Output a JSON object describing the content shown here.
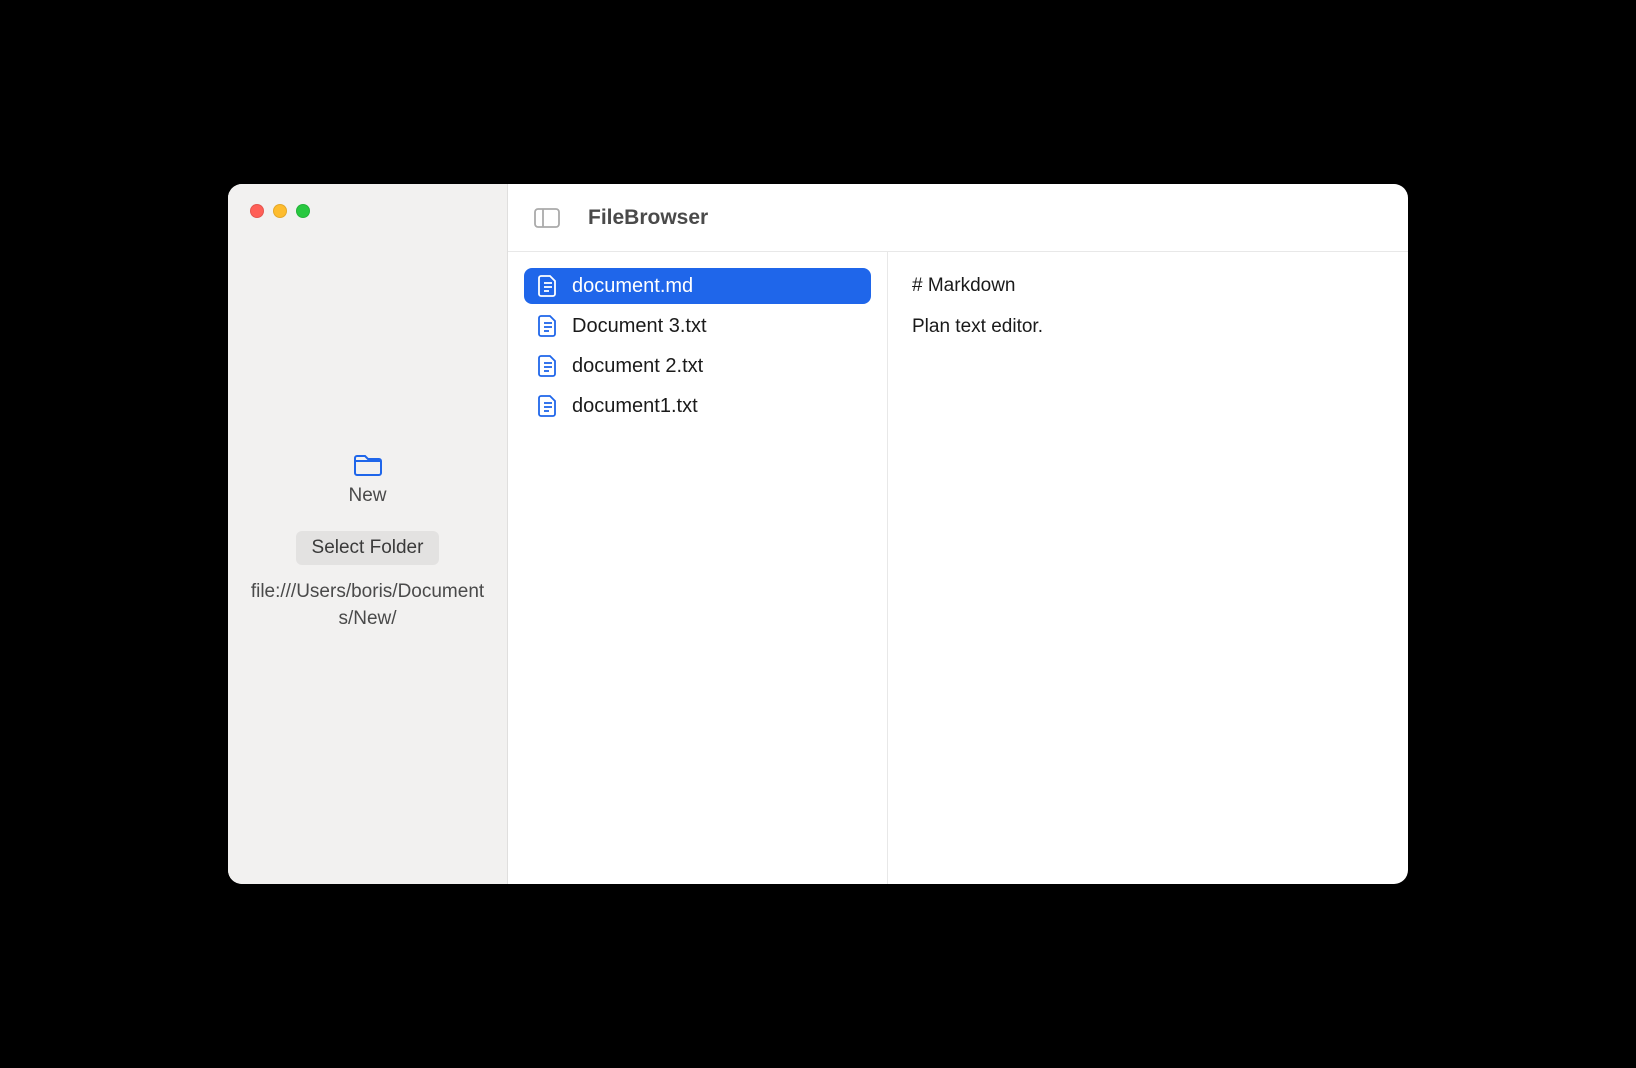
{
  "sidebar": {
    "folder_name": "New",
    "select_folder_label": "Select Folder",
    "folder_path": "file:///Users/boris/Documents/New/"
  },
  "toolbar": {
    "title": "FileBrowser"
  },
  "files": [
    {
      "name": "document.md",
      "selected": true
    },
    {
      "name": "Document 3.txt",
      "selected": false
    },
    {
      "name": "document 2.txt",
      "selected": false
    },
    {
      "name": "document1.txt",
      "selected": false
    }
  ],
  "editor": {
    "lines": [
      "# Markdown",
      "Plan text editor."
    ]
  },
  "colors": {
    "accent": "#1f66ea",
    "folder_icon": "#1f66ea"
  }
}
